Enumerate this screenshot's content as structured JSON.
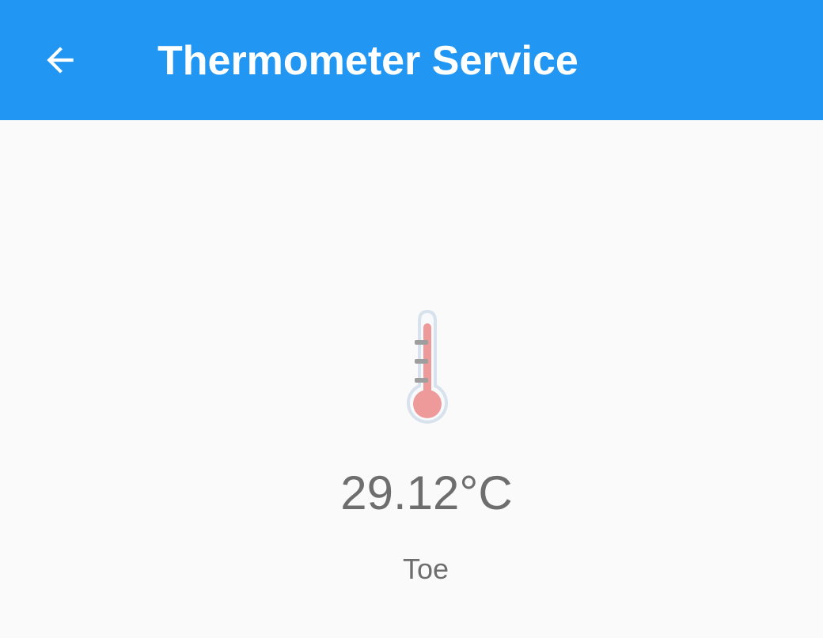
{
  "app_bar": {
    "title": "Thermometer Service",
    "back_icon": "arrow-back-icon",
    "background_color": "#2196f3"
  },
  "reading": {
    "icon": "thermometer-icon",
    "temperature": "29.12°C",
    "location": "Toe"
  }
}
